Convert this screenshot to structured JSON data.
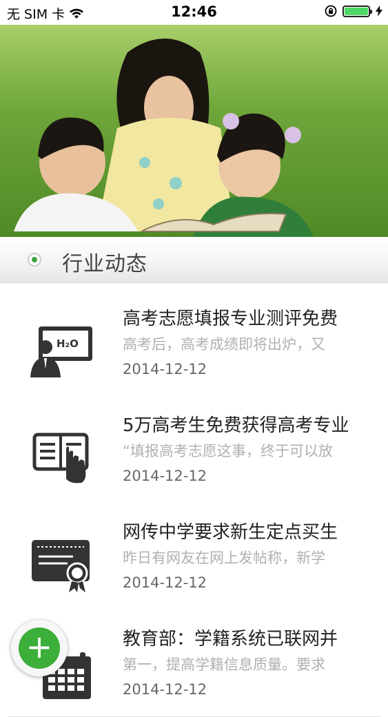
{
  "status_bar": {
    "carrier": "无 SIM 卡",
    "time": "12:46",
    "icons": [
      "wifi-icon",
      "rotation-lock-icon",
      "battery-icon",
      "charging-icon"
    ]
  },
  "banner": {
    "image": "mother reading a book with two children on grass"
  },
  "section": {
    "title": "行业动态"
  },
  "news": [
    {
      "title": "高考志愿填报专业测评免费",
      "summary": "高考后，高考成绩即将出炉，又",
      "date": "2014-12-12",
      "icon": "teacher-board-icon"
    },
    {
      "title": "5万高考生免费获得高考专业",
      "summary": "“填报高考志愿这事，终于可以放",
      "date": "2014-12-12",
      "icon": "document-hand-icon"
    },
    {
      "title": "网传中学要求新生定点买生",
      "summary": "昨日有网友在网上发帖称，新学",
      "date": "2014-12-12",
      "icon": "certificate-icon"
    },
    {
      "title": "教育部：学籍系统已联网并",
      "summary": "第一，提高学籍信息质量。要求",
      "date": "2014-12-12",
      "icon": "calendar-icon"
    }
  ],
  "fab": {
    "label": "+"
  },
  "colors": {
    "accent": "#3cae3a",
    "title": "#222222",
    "summary": "#b0b0b0",
    "date": "#666666"
  }
}
